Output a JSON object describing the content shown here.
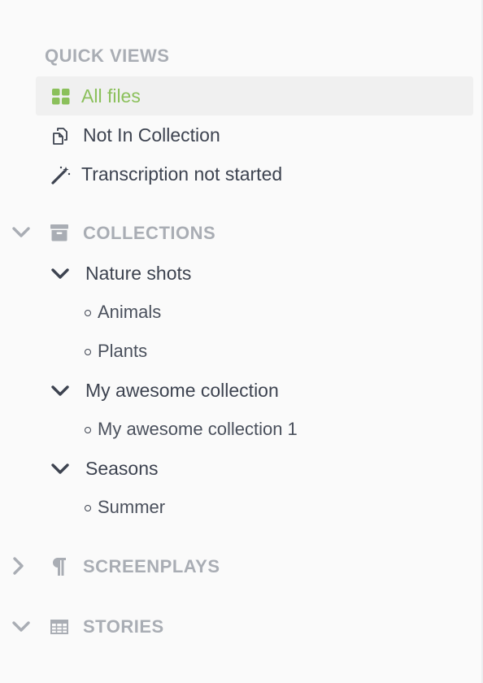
{
  "quick_views": {
    "title": "QUICK VIEWS",
    "items": [
      {
        "label": "All files",
        "icon": "grid-icon",
        "active": true
      },
      {
        "label": "Not In Collection",
        "icon": "copy-docs-icon",
        "active": false
      },
      {
        "label": "Transcription not started",
        "icon": "magic-wand-icon",
        "active": false
      }
    ]
  },
  "collections": {
    "title": "COLLECTIONS",
    "icon": "archive-box-icon",
    "expanded": true,
    "groups": [
      {
        "name": "Nature shots",
        "children": [
          "Animals",
          "Plants"
        ]
      },
      {
        "name": "My awesome collection",
        "children": [
          "My awesome collection 1"
        ]
      },
      {
        "name": "Seasons",
        "children": [
          "Summer"
        ]
      }
    ]
  },
  "screenplays": {
    "title": "SCREENPLAYS",
    "icon": "pilcrow-icon",
    "expanded": false
  },
  "stories": {
    "title": "STORIES",
    "icon": "table-icon",
    "expanded": true
  },
  "colors": {
    "accent": "#8bc05b",
    "text": "#3d4350",
    "muted": "#a9adb4",
    "active_bg": "#f0f0f0",
    "background": "#fafafa"
  }
}
